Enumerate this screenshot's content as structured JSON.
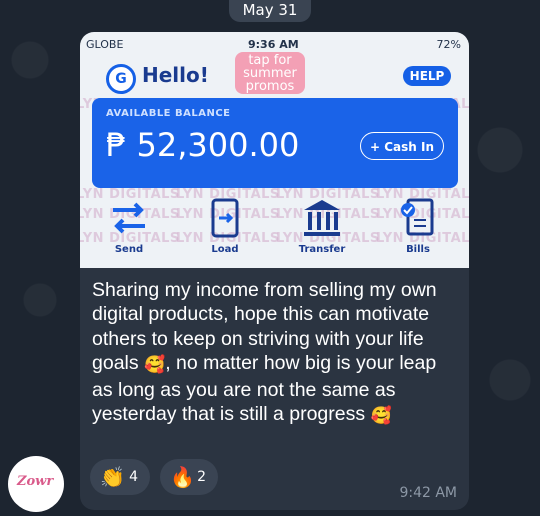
{
  "chat": {
    "date_label": "May 31",
    "message": {
      "text_parts": [
        "Sharing my income from selling my own digital products, hope this can motivate others to keep on striving with your life goals ",
        "🥰",
        ", no matter how big is your leap as long as you are not the same as yesterday that is still a progress ",
        "🥰"
      ],
      "time": "9:42 AM",
      "reactions": [
        {
          "emoji": "👏",
          "count": "4"
        },
        {
          "emoji": "🔥",
          "count": "2"
        }
      ]
    },
    "sender_avatar": {
      "logo_text": "Zowr"
    }
  },
  "screenshot": {
    "status_bar": {
      "carrier": "GLOBE",
      "time": "9:36 AM",
      "battery": "72%"
    },
    "greeting": "Hello!",
    "promo_text": "tap for summer promos",
    "help_label": "HELP",
    "balance_label": "AVAILABLE BALANCE",
    "balance_amount": "₱ 52,300.00",
    "cashin_label": "+ Cash In",
    "actions": [
      "Send",
      "Load",
      "Transfer",
      "Bills"
    ],
    "watermark_text": "LYN DIGITALS"
  },
  "colors": {
    "gcash_blue": "#1a63e8",
    "bubble": "#2b3441",
    "reaction_bg": "#3a4453"
  }
}
